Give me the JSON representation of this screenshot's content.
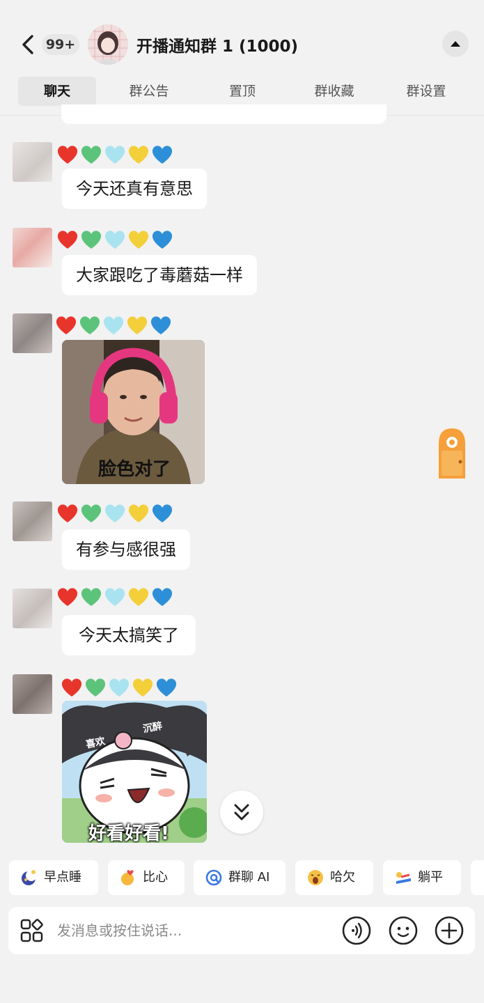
{
  "header": {
    "unread_badge": "99+",
    "title": "开播通知群 1 (1000)",
    "tabs": [
      "聊天",
      "群公告",
      "置顶",
      "群收藏",
      "群设置"
    ]
  },
  "messages": [
    {
      "type": "text",
      "text": "今天还真有意思"
    },
    {
      "type": "text",
      "text": "大家跟吃了毒蘑菇一样"
    },
    {
      "type": "sticker",
      "caption": "脸色对了"
    },
    {
      "type": "text",
      "text": "有参与感很强"
    },
    {
      "type": "text",
      "text": "今天太搞笑了"
    },
    {
      "type": "sticker",
      "caption": "好看好看!",
      "tags": [
        "喜欢",
        "沉醉"
      ]
    }
  ],
  "quick_replies": [
    "早点睡",
    "比心",
    "群聊 AI",
    "哈欠",
    "躺平"
  ],
  "input": {
    "placeholder": "发消息或按住说话..."
  },
  "icons": {
    "back": "chevron-left-icon",
    "collapse": "caret-up-icon",
    "apps": "apps-grid-icon",
    "voice": "voice-icon",
    "emoji": "emoji-icon",
    "plus": "plus-icon",
    "scroll": "double-chevron-down-icon",
    "door": "door-icon"
  },
  "colors": {
    "background": "#f2f2f2",
    "bubble": "#ffffff",
    "heart_colors": [
      "#e8352c",
      "#5cc47a",
      "#a9e3ef",
      "#f3cf3a",
      "#2d8fd8"
    ]
  }
}
